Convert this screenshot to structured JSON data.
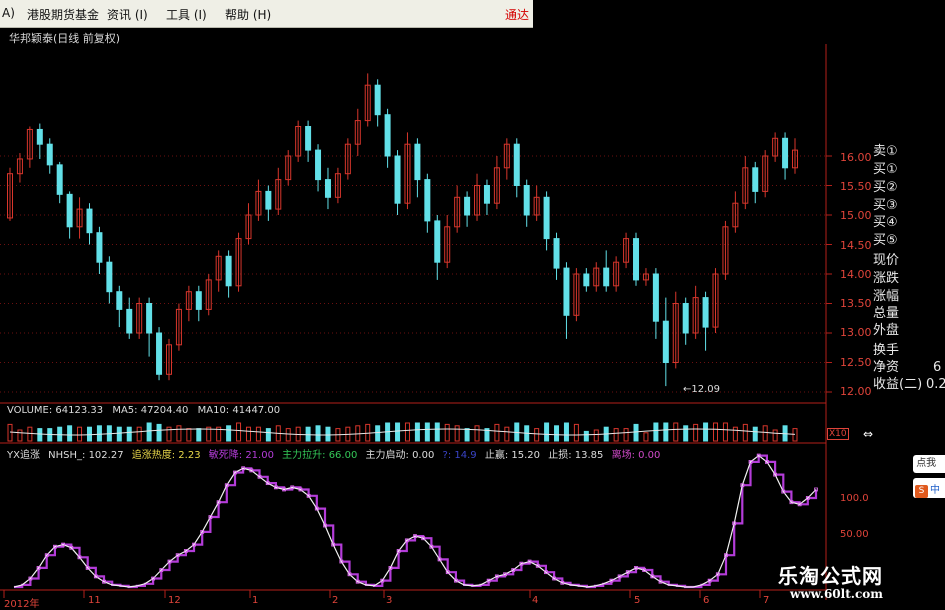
{
  "menubar": {
    "items": [
      "A)",
      "港股期货基金",
      "资讯 (I)",
      "工具 (I)",
      "帮助 (H)"
    ],
    "brand": "通达"
  },
  "chart_title": "华邦颖泰(日线 前复权)",
  "price_axis": [
    "16.00",
    "15.50",
    "15.00",
    "14.50",
    "14.00",
    "13.50",
    "13.00",
    "12.50",
    "12.00"
  ],
  "low_marker": "←12.09",
  "side_panel": [
    "卖①",
    "买①",
    "买②",
    "买③",
    "买④",
    "买⑤",
    "现价",
    "涨跌",
    "涨幅",
    "总量",
    "外盘",
    "换手",
    "净资",
    "收益(二)"
  ],
  "side_values": [
    "6",
    "0.2"
  ],
  "volume_legend": {
    "volume": "VOLUME: 64123.33",
    "ma5": "MA5: 47204.40",
    "ma10": "MA10: 41447.00",
    "x10": "X10",
    "toggle": "⇔"
  },
  "indicator_legend": {
    "name": "YX追涨",
    "nhsh": "NHSH_: 102.27",
    "heat": "追涨热度: 2.23",
    "sensitive": "敏死降: 21.00",
    "main_up": "主力拉升: 66.00",
    "main_start": "主力启动: 0.00",
    "hidden": "?: 14.9",
    "stop_win": "止赢: 15.20",
    "stop_loss": "止损: 13.85",
    "exit": "离场: 0.00"
  },
  "indicator_axis": [
    "100.0",
    "50.00"
  ],
  "date_axis": [
    "2012年",
    "11",
    "12",
    "1",
    "2",
    "3",
    "4",
    "5",
    "6",
    "7"
  ],
  "watermark": {
    "title": "乐淘公式网",
    "url": "www.60lt.com"
  },
  "float_buttons": {
    "top": "点我",
    "bottom": "中"
  },
  "colors": {
    "up": "#d8362c",
    "down": "#62e0e8",
    "purple": "#b43cd9",
    "axis": "#b4201a",
    "grid": "#6b1010"
  },
  "chart_data": {
    "type": "candlestick",
    "price_range": [
      12.0,
      16.2
    ],
    "candles": [
      [
        14.95,
        15.7,
        15.8,
        14.9
      ],
      [
        15.7,
        15.95,
        16.05,
        15.55
      ],
      [
        15.95,
        16.45,
        16.5,
        15.8
      ],
      [
        16.45,
        16.2,
        16.55,
        15.95
      ],
      [
        16.2,
        15.85,
        16.3,
        15.7
      ],
      [
        15.85,
        15.35,
        15.9,
        15.2
      ],
      [
        15.35,
        14.8,
        15.4,
        14.6
      ],
      [
        14.8,
        15.1,
        15.3,
        14.6
      ],
      [
        15.1,
        14.7,
        15.2,
        14.5
      ],
      [
        14.7,
        14.2,
        14.8,
        14.0
      ],
      [
        14.2,
        13.7,
        14.3,
        13.5
      ],
      [
        13.7,
        13.4,
        13.8,
        13.1
      ],
      [
        13.4,
        13.0,
        13.6,
        12.9
      ],
      [
        13.0,
        13.5,
        13.6,
        12.9
      ],
      [
        13.5,
        13.0,
        13.6,
        12.6
      ],
      [
        13.0,
        12.3,
        13.1,
        12.2
      ],
      [
        12.3,
        12.8,
        12.9,
        12.2
      ],
      [
        12.8,
        13.4,
        13.5,
        12.7
      ],
      [
        13.4,
        13.7,
        13.8,
        13.2
      ],
      [
        13.7,
        13.4,
        13.8,
        13.2
      ],
      [
        13.4,
        13.9,
        14.0,
        13.3
      ],
      [
        13.9,
        14.3,
        14.4,
        13.7
      ],
      [
        14.3,
        13.8,
        14.4,
        13.6
      ],
      [
        13.8,
        14.6,
        14.7,
        13.7
      ],
      [
        14.6,
        15.0,
        15.2,
        14.5
      ],
      [
        15.0,
        15.4,
        15.6,
        14.9
      ],
      [
        15.4,
        15.1,
        15.5,
        14.9
      ],
      [
        15.1,
        15.6,
        15.8,
        15.0
      ],
      [
        15.6,
        16.0,
        16.1,
        15.5
      ],
      [
        16.0,
        16.5,
        16.6,
        15.9
      ],
      [
        16.5,
        16.1,
        16.6,
        15.9
      ],
      [
        16.1,
        15.6,
        16.2,
        15.4
      ],
      [
        15.6,
        15.3,
        15.8,
        15.1
      ],
      [
        15.3,
        15.7,
        15.8,
        15.2
      ],
      [
        15.7,
        16.2,
        16.3,
        15.6
      ],
      [
        16.2,
        16.6,
        16.8,
        16.0
      ],
      [
        16.6,
        17.2,
        17.4,
        16.5
      ],
      [
        17.2,
        16.7,
        17.3,
        16.5
      ],
      [
        16.7,
        16.0,
        16.8,
        15.8
      ],
      [
        16.0,
        15.2,
        16.1,
        15.0
      ],
      [
        15.2,
        16.2,
        16.4,
        15.1
      ],
      [
        16.2,
        15.6,
        16.3,
        15.3
      ],
      [
        15.6,
        14.9,
        15.7,
        14.7
      ],
      [
        14.9,
        14.2,
        15.0,
        13.9
      ],
      [
        14.2,
        14.8,
        15.0,
        14.1
      ],
      [
        14.8,
        15.3,
        15.5,
        14.7
      ],
      [
        15.3,
        15.0,
        15.4,
        14.8
      ],
      [
        15.0,
        15.5,
        15.7,
        14.9
      ],
      [
        15.5,
        15.2,
        15.6,
        15.0
      ],
      [
        15.2,
        15.8,
        16.0,
        15.1
      ],
      [
        15.8,
        16.2,
        16.3,
        15.6
      ],
      [
        16.2,
        15.5,
        16.3,
        15.3
      ],
      [
        15.5,
        15.0,
        15.6,
        14.8
      ],
      [
        15.0,
        15.3,
        15.5,
        14.9
      ],
      [
        15.3,
        14.6,
        15.4,
        14.4
      ],
      [
        14.6,
        14.1,
        14.7,
        13.9
      ],
      [
        14.1,
        13.3,
        14.2,
        12.9
      ],
      [
        13.3,
        14.0,
        14.1,
        13.2
      ],
      [
        14.0,
        13.8,
        14.1,
        13.7
      ],
      [
        13.8,
        14.1,
        14.2,
        13.7
      ],
      [
        14.1,
        13.8,
        14.4,
        13.7
      ],
      [
        13.8,
        14.2,
        14.3,
        13.7
      ],
      [
        14.2,
        14.6,
        14.7,
        14.1
      ],
      [
        14.6,
        13.9,
        14.7,
        13.8
      ],
      [
        13.9,
        14.0,
        14.1,
        13.8
      ],
      [
        14.0,
        13.2,
        14.1,
        12.9
      ],
      [
        13.2,
        12.5,
        13.6,
        12.1
      ],
      [
        12.5,
        13.5,
        13.7,
        12.4
      ],
      [
        13.5,
        13.0,
        13.6,
        12.8
      ],
      [
        13.0,
        13.6,
        13.8,
        12.9
      ],
      [
        13.6,
        13.1,
        13.7,
        12.7
      ],
      [
        13.1,
        14.0,
        14.1,
        13.0
      ],
      [
        14.0,
        14.8,
        14.9,
        13.9
      ],
      [
        14.8,
        15.2,
        15.4,
        14.7
      ],
      [
        15.2,
        15.8,
        16.0,
        15.1
      ],
      [
        15.8,
        15.4,
        15.9,
        15.2
      ],
      [
        15.4,
        16.0,
        16.1,
        15.3
      ],
      [
        16.0,
        16.3,
        16.4,
        15.9
      ],
      [
        16.3,
        15.8,
        16.4,
        15.6
      ],
      [
        15.8,
        16.1,
        16.3,
        15.7
      ]
    ],
    "indicator": [
      0,
      2,
      8,
      18,
      30,
      38,
      40,
      37,
      28,
      18,
      10,
      5,
      2,
      1,
      0,
      1,
      3,
      8,
      16,
      24,
      30,
      34,
      40,
      52,
      66,
      80,
      96,
      108,
      112,
      110,
      104,
      98,
      94,
      92,
      94,
      92,
      86,
      74,
      58,
      40,
      24,
      12,
      5,
      2,
      1,
      6,
      18,
      34,
      44,
      48,
      46,
      38,
      26,
      14,
      6,
      2,
      1,
      2,
      6,
      10,
      12,
      16,
      22,
      24,
      20,
      14,
      8,
      4,
      2,
      1,
      0,
      1,
      3,
      6,
      10,
      14,
      18,
      16,
      10,
      5,
      2,
      1,
      0,
      0,
      2,
      6,
      12,
      30,
      60,
      96,
      118,
      124,
      118,
      106,
      90,
      80,
      78,
      84,
      92
    ]
  }
}
